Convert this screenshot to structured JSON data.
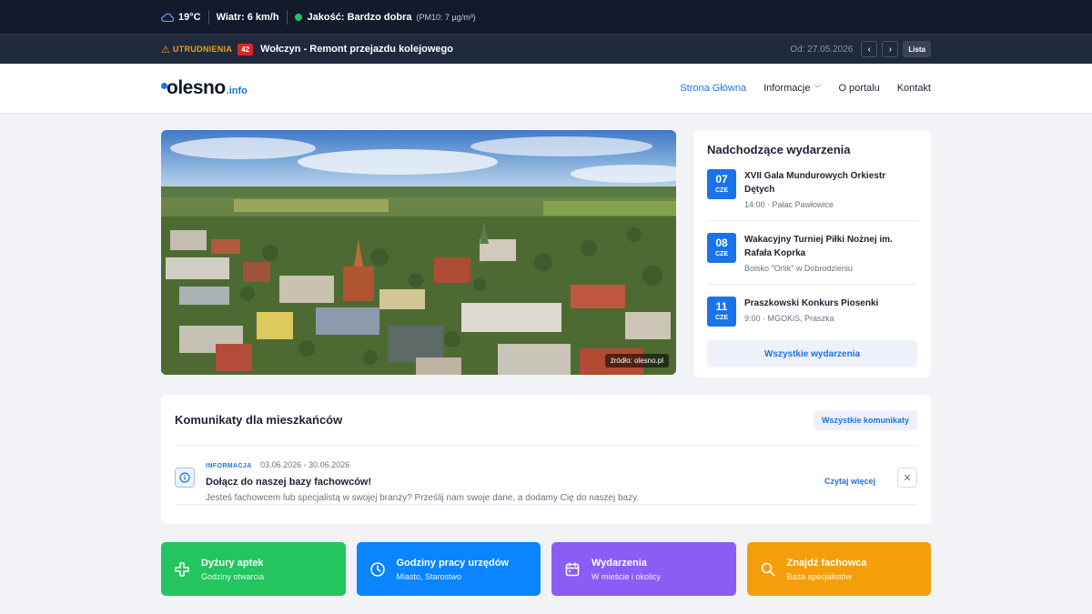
{
  "topbar": {
    "temperature": "19°C",
    "wind": "Wiatr: 6 km/h",
    "air_quality": "Jakość: Bardzo dobra",
    "pm10": "(PM10: 7 µg/m³)"
  },
  "alerts": {
    "label": "UTRUDNIENIA",
    "count": "42",
    "title": "Wołczyn - Remont przejazdu kolejowego",
    "date": "Od: 27.05.2026",
    "prev": "‹",
    "next": "›",
    "list_label": "Lista"
  },
  "header": {
    "logo_main": "olesno",
    "logo_sub": ".info",
    "menu": [
      "Strona Główna",
      "Informacje",
      "O portalu",
      "Kontakt"
    ]
  },
  "hero": {
    "credit": "źródło: olesno.pl"
  },
  "events": {
    "title": "Nadchodzące wydarzenia",
    "items": [
      {
        "day": "07",
        "month": "CZE",
        "title": "XVII Gala Mundurowych Orkiestr Dętych",
        "meta": "14:00 · Pałac Pawłowice"
      },
      {
        "day": "08",
        "month": "CZE",
        "title": "Wakacyjny Turniej Piłki Nożnej im. Rafała Koprka",
        "meta": "Boisko \"Orlik\" w Dobrodzieniu"
      },
      {
        "day": "11",
        "month": "CZE",
        "title": "Praszkowski Konkurs Piosenki",
        "meta": "9:00 · MGOKiS, Praszka"
      }
    ],
    "all_label": "Wszystkie wydarzenia"
  },
  "notices": {
    "title": "Komunikaty dla mieszkańców",
    "all_label": "Wszystkie komunikaty",
    "item": {
      "category": "INFORMACJA",
      "dates": "03.06.2026 - 30.06.2026",
      "title": "Dołącz do naszej bazy fachowców!",
      "text": "Jesteś fachowcem lub specjalistą w swojej branży? Prześlij nam swoje dane, a dodamy Cię do naszej bazy.",
      "read_more": "Czytaj więcej",
      "close": "✕"
    }
  },
  "tiles": [
    {
      "title": "Dyżury aptek",
      "subtitle": "Godziny otwarcia",
      "color": "#22c55e",
      "icon": "plus-icon"
    },
    {
      "title": "Godziny pracy urzędów",
      "subtitle": "Miasto, Starostwo",
      "color": "#0a84ff",
      "icon": "clock-icon"
    },
    {
      "title": "Wydarzenia",
      "subtitle": "W mieście i okolicy",
      "color": "#8b5cf6",
      "icon": "calendar-icon"
    },
    {
      "title": "Znajdź fachowca",
      "subtitle": "Baza specjalistów",
      "color": "#f59e0b",
      "icon": "search-icon"
    }
  ]
}
